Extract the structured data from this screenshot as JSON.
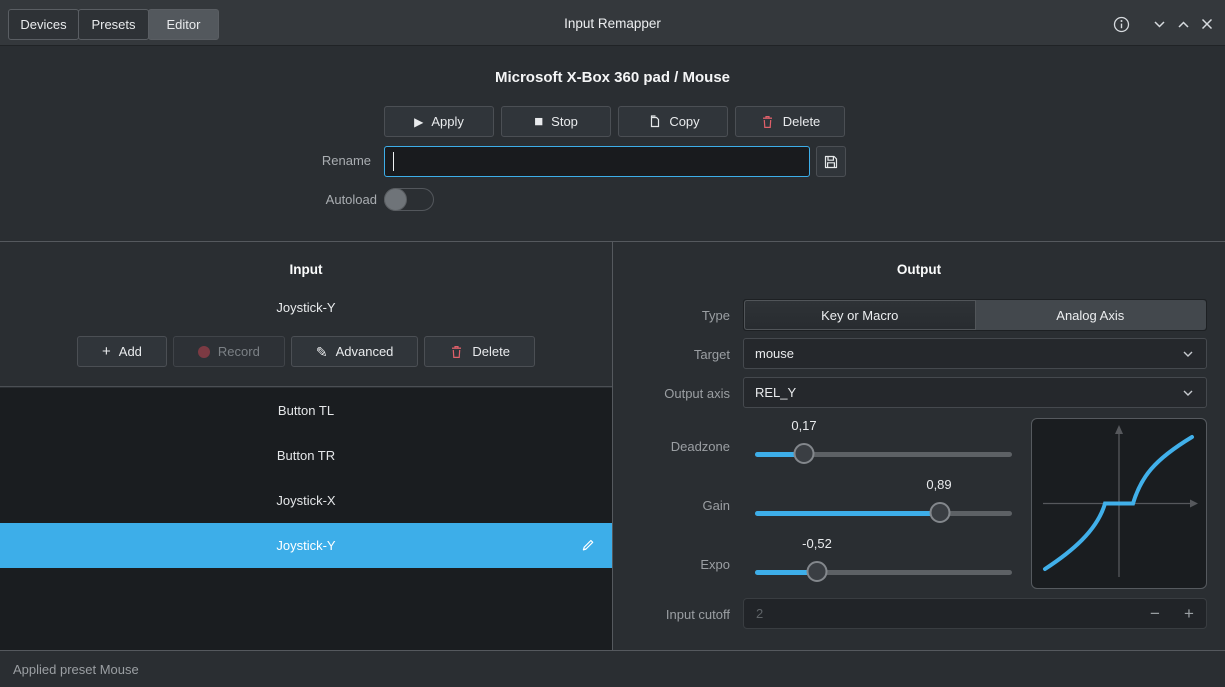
{
  "titlebar": {
    "tabs": [
      {
        "label": "Devices",
        "active": false
      },
      {
        "label": "Presets",
        "active": false
      },
      {
        "label": "Editor",
        "active": true
      }
    ],
    "title": "Input Remapper"
  },
  "preset_header": {
    "device_title": "Microsoft X-Box 360 pad  /  Mouse",
    "apply_label": "Apply",
    "stop_label": "Stop",
    "copy_label": "Copy",
    "delete_label": "Delete",
    "rename_label": "Rename",
    "rename_value": "",
    "autoload_label": "Autoload",
    "autoload_on": false
  },
  "input_panel": {
    "heading": "Input",
    "active_input": "Joystick-Y",
    "add_label": "Add",
    "record_label": "Record",
    "advanced_label": "Advanced",
    "delete_label": "Delete",
    "list": [
      {
        "label": "Button TL",
        "selected": false
      },
      {
        "label": "Button TR",
        "selected": false
      },
      {
        "label": "Joystick-X",
        "selected": false
      },
      {
        "label": "Joystick-Y",
        "selected": true
      }
    ]
  },
  "output_panel": {
    "heading": "Output",
    "type_label": "Type",
    "type_options": [
      {
        "label": "Key or Macro",
        "selected": false
      },
      {
        "label": "Analog Axis",
        "selected": true
      }
    ],
    "target_label": "Target",
    "target_value": "mouse",
    "output_axis_label": "Output axis",
    "output_axis_value": "REL_Y",
    "sliders": {
      "deadzone": {
        "label": "Deadzone",
        "value": "0,17",
        "percent": 19
      },
      "gain": {
        "label": "Gain",
        "value": "0,89",
        "percent": 72
      },
      "expo": {
        "label": "Expo",
        "value": "-0,52",
        "percent": 24
      }
    },
    "input_cutoff_label": "Input cutoff",
    "input_cutoff_value": "2",
    "graph": {
      "type": "line",
      "description": "output response curve with center deadzone plateau",
      "deadzone": 0.17,
      "gain": 0.89,
      "expo": -0.52
    }
  },
  "statusbar": {
    "message": "Applied preset Mouse"
  },
  "icons": {
    "play": "▶",
    "stop": "■",
    "add": "+",
    "pencil": "✎",
    "minus": "−",
    "plus": "+"
  },
  "colors": {
    "accent": "#3daee9",
    "danger": "#e0606a",
    "titlebar_bg": "#34383c",
    "panel_bg": "#2a2e32",
    "list_bg": "#1a1d20"
  }
}
